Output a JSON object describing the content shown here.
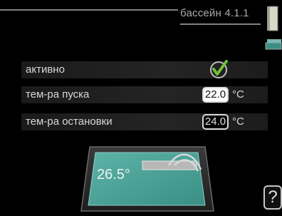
{
  "header": {
    "breadcrumb": "бассейн 4.1.1"
  },
  "rows": [
    {
      "label": "активно",
      "checked": true
    },
    {
      "label": "тем-ра пуска",
      "value": "22.0",
      "unit": "°C"
    },
    {
      "label": "тем-ра остановки",
      "value": "24.0",
      "unit": "°C"
    }
  ],
  "pool": {
    "temperature": "26.5°"
  },
  "help": {
    "label": "?"
  },
  "colors": {
    "pool_water": "#4fa59a",
    "check": "#6fbf3a",
    "accent": "#3d8f85"
  }
}
